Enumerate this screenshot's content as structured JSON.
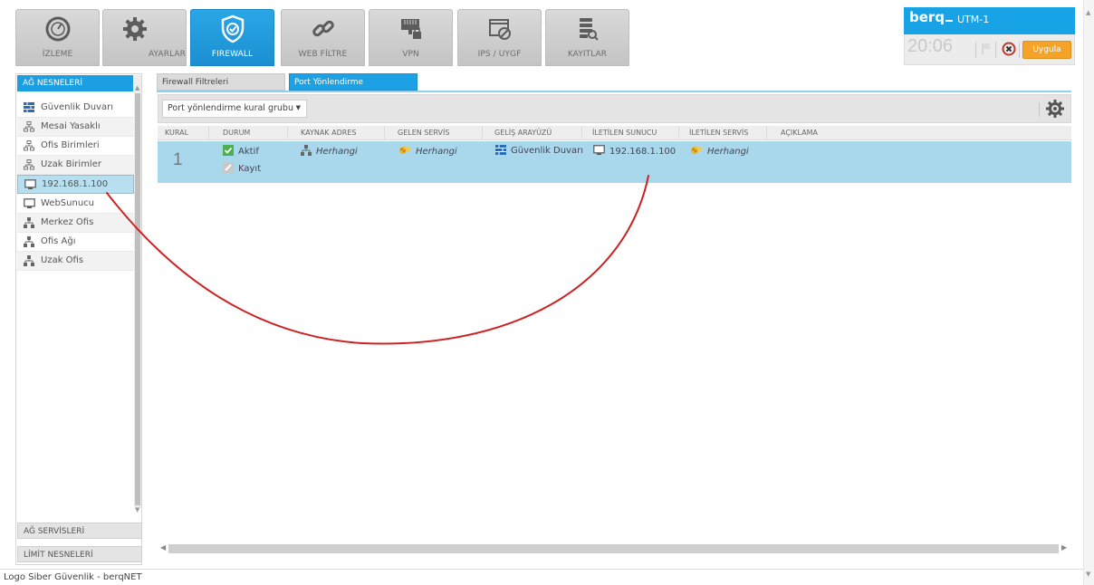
{
  "toolbar": {
    "tabs": [
      {
        "label": "İZLEME",
        "icon": "gauge-icon"
      },
      {
        "label": "AYARLAR",
        "icon": "gear-icon"
      },
      {
        "label": "FIREWALL",
        "icon": "shield-check-icon",
        "active": true
      },
      {
        "label": "WEB FİLTRE",
        "icon": "link-icon"
      },
      {
        "label": "VPN",
        "icon": "network-lock-icon"
      },
      {
        "label": "IPS / UYGF",
        "icon": "window-block-icon"
      },
      {
        "label": "KAYITLAR",
        "icon": "log-search-icon"
      }
    ]
  },
  "brand": {
    "logo": "berq",
    "model": "UTM-1",
    "time": "20:06",
    "apply_label": "Uygula"
  },
  "left_panel": {
    "header": "AĞ NESNELERİ",
    "items": [
      {
        "label": "Güvenlik Duvarı",
        "icon": "firewall-icon"
      },
      {
        "label": "Mesai Yasaklı",
        "icon": "group-icon"
      },
      {
        "label": "Ofis Birimleri",
        "icon": "group-icon"
      },
      {
        "label": "Uzak Birimler",
        "icon": "group-icon"
      },
      {
        "label": "192.168.1.100",
        "icon": "monitor-icon",
        "selected": true
      },
      {
        "label": "WebSunucu",
        "icon": "monitor-icon"
      },
      {
        "label": "Merkez Ofis",
        "icon": "network-icon"
      },
      {
        "label": "Ofis Ağı",
        "icon": "network-icon"
      },
      {
        "label": "Uzak Ofis",
        "icon": "network-icon"
      }
    ],
    "footer_sections": [
      "AĞ SERVİSLERİ",
      "LİMİT NESNELERİ"
    ]
  },
  "content": {
    "tabs": [
      "Firewall Filtreleri",
      "Port Yönlendirme"
    ],
    "active_tab": "Port Yönlendirme",
    "group_select": "Port yönlendirme kural grubu",
    "columns": [
      "KURAL",
      "DURUM",
      "KAYNAK ADRES",
      "GELEN SERVİS",
      "GELİŞ ARAYÜZÜ",
      "İLETİLEN SUNUCU",
      "İLETİLEN SERVİS",
      "AÇIKLAMA"
    ],
    "rows": [
      {
        "rule": "1",
        "status_active": "Aktif",
        "status_log": "Kayıt",
        "source": "Herhangi",
        "incoming_service": "Herhangi",
        "interface": "Güvenlik Duvarı",
        "target_server": "192.168.1.100",
        "target_service": "Herhangi",
        "description": ""
      }
    ]
  },
  "footer": {
    "text": "Logo Siber Güvenlik - berqNET"
  },
  "colors": {
    "accent": "#1ca2e4",
    "apply": "#f4a326",
    "selected_row": "#a9d8ec",
    "annotation": "#cc2222"
  }
}
